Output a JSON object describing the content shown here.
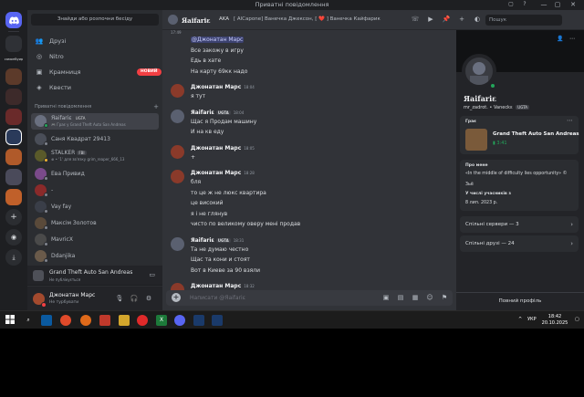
{
  "window": {
    "title": "Приватні повідомлення"
  },
  "rail": {
    "servers": [
      {
        "label": "",
        "color": "#5865f2"
      },
      {
        "label": "",
        "color": "#2f3136"
      },
      {
        "label": "",
        "color": "#5c3a2a"
      },
      {
        "label": "",
        "color": "#3d2a2a"
      },
      {
        "label": "",
        "color": "#6a2a2a"
      },
      {
        "label": "",
        "color": "#2a3a5a"
      },
      {
        "label": "",
        "color": "#b05a2a"
      },
      {
        "label": "",
        "color": "#4a4a5a"
      },
      {
        "label": "",
        "color": "#3a2a4a"
      },
      {
        "label": "",
        "color": "#c0602a"
      },
      {
        "label": "",
        "color": "#2b2d31"
      },
      {
        "label": "",
        "color": "#2b2d31"
      }
    ],
    "group_label": "самонбуир"
  },
  "sidebar": {
    "search_button": "Знайди або розпочни бесіду",
    "nav": [
      {
        "label": "Друзі",
        "icon": "friends-icon"
      },
      {
        "label": "Nitro",
        "icon": "nitro-icon"
      },
      {
        "label": "Крамниця",
        "icon": "shop-icon",
        "badge": "НОВИЙ"
      },
      {
        "label": "Квести",
        "icon": "quests-icon"
      }
    ],
    "section_title": "Приватні повідомлення",
    "dms": [
      {
        "name": "Яаifariɛ",
        "tag": "UGTA",
        "sub": "🎮 Грає у Grand Theft Auto San Andreas",
        "avatar": "#6a7080",
        "status": "#23a55a",
        "active": true
      },
      {
        "name": "Саня Квадрат 29413",
        "tag": "",
        "sub": "",
        "avatar": "#4a4e58",
        "status": "#80848e",
        "active": false
      },
      {
        "name": "STALKER",
        "tag": "FBI",
        "sub": "⊕ • '1' для зв'язку grim_reaper_666_13",
        "avatar": "#5a5a2a",
        "status": "#f0b232",
        "active": false
      },
      {
        "name": "Ева Привид",
        "tag": "",
        "sub": "",
        "avatar": "#7a4a8a",
        "status": "#80848e",
        "active": false
      },
      {
        "name": "-",
        "tag": "",
        "sub": "",
        "avatar": "#8a2a2a",
        "status": "#80848e",
        "active": false
      },
      {
        "name": "Vay fay",
        "tag": "",
        "sub": "",
        "avatar": "#3a3e48",
        "status": "#80848e",
        "active": false
      },
      {
        "name": "Максім Золотов",
        "tag": "",
        "sub": "",
        "avatar": "#5a4a3a",
        "status": "#80848e",
        "active": false
      },
      {
        "name": "MavricX",
        "tag": "",
        "sub": "",
        "avatar": "#4a4a4a",
        "status": "#80848e",
        "active": false
      },
      {
        "name": "Ddanjika",
        "tag": "",
        "sub": "",
        "avatar": "#6a5a4a",
        "status": "#80848e",
        "active": false
      }
    ],
    "activity": {
      "title": "Grand Theft Auto San Andreas",
      "sub": "Не публікується"
    },
    "user": {
      "name": "Джонатан Марс",
      "status": "Не турбувати"
    }
  },
  "header": {
    "name": "Яаifariɛ",
    "aka_label": "AKA",
    "aka_names": "[ AlCapone] Ванечка Джексон, [ ❤️ ] Ванечка Кайфарик",
    "search_placeholder": "Пошук"
  },
  "chat": {
    "top_time": "17:49",
    "top_name": "Яаifariɛ",
    "top_tag": "UGTA",
    "messages": [
      {
        "type": "mention",
        "text": "@Джонатан Марс"
      },
      {
        "type": "line",
        "text": "Все закожу в игру"
      },
      {
        "type": "line",
        "text": "Едь в хате"
      },
      {
        "type": "line",
        "text": "На карту 69кк надо"
      },
      {
        "type": "header",
        "name": "Джонатан Марс",
        "time": "18:04",
        "avatar": "#8a3a2a"
      },
      {
        "type": "line",
        "text": "я тут"
      },
      {
        "type": "header",
        "name": "Яаifariɛ",
        "tag": "UGTA",
        "time": "18:04",
        "avatar": "#5a6070"
      },
      {
        "type": "line",
        "text": "Щас я Продам машину"
      },
      {
        "type": "line",
        "text": "И на кв еду"
      },
      {
        "type": "header",
        "name": "Джонатан Марс",
        "time": "18:05",
        "avatar": "#8a3a2a"
      },
      {
        "type": "line",
        "text": "+"
      },
      {
        "type": "header",
        "name": "Джонатан Марс",
        "time": "18:28",
        "avatar": "#8a3a2a"
      },
      {
        "type": "line",
        "text": "бля"
      },
      {
        "type": "line",
        "text": "то це ж не люкс квартира"
      },
      {
        "type": "line",
        "text": "це високий"
      },
      {
        "type": "line",
        "text": "я і не глянув"
      },
      {
        "type": "line",
        "text": "чисто по великому оверу мені продав"
      },
      {
        "type": "header",
        "name": "Яаifariɛ",
        "tag": "UGTA",
        "time": "18:31",
        "avatar": "#5a6070"
      },
      {
        "type": "line",
        "text": "Та не думаю честно"
      },
      {
        "type": "line",
        "text": "Щас та кони и стоят"
      },
      {
        "type": "line",
        "text": "Вот в Киеве за 90 взяли"
      },
      {
        "type": "header",
        "name": "Джонатан Марс",
        "time": "18:32",
        "avatar": "#8a3a2a"
      },
      {
        "type": "line",
        "text": "так в киеве ж за 90 високий"
      }
    ],
    "composer_placeholder": "Написати @Яаifariɛ"
  },
  "profile": {
    "name": "Яаifariɛ",
    "username": "mr_zadrot. • Vaneckɛ",
    "tag": "UGTA",
    "playing_label": "Грає",
    "game_title": "Grand Theft Auto San Andreas",
    "game_time": "3:41",
    "about_label": "Про мене",
    "about_text": "«In the middle of difficulty lies opportunity» ©",
    "about_author": "3ьё",
    "member_since_label": "У числі учасників з",
    "member_since": "8 лип. 2023 р.",
    "mutual_servers": "Спільні сервери — 3",
    "mutual_friends": "Спільні друзі — 24",
    "full_profile": "Повний профіль"
  },
  "taskbar": {
    "lang": "УКР",
    "time": "18:42",
    "date": "20.10.2025"
  },
  "colors": {
    "accent": "#5865f2",
    "online": "#23a55a",
    "dnd": "#f23f43"
  }
}
